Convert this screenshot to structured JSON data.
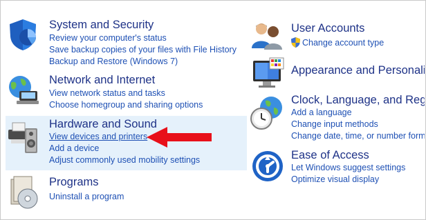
{
  "left_column": [
    {
      "id": "system-security",
      "title": "System and Security",
      "icon": "shield-icon",
      "links": [
        "Review your computer's status",
        "Save backup copies of your files with File History",
        "Backup and Restore (Windows 7)"
      ]
    },
    {
      "id": "network-internet",
      "title": "Network and Internet",
      "icon": "globe-network-icon",
      "links": [
        "View network status and tasks",
        "Choose homegroup and sharing options"
      ]
    },
    {
      "id": "hardware-sound",
      "title": "Hardware and Sound",
      "icon": "printer-speaker-icon",
      "links": [
        "View devices and printers",
        "Add a device",
        "Adjust commonly used mobility settings"
      ],
      "highlighted": true
    },
    {
      "id": "programs",
      "title": "Programs",
      "icon": "programs-disc-icon",
      "links": [
        "Uninstall a program"
      ]
    }
  ],
  "right_column": [
    {
      "id": "user-accounts",
      "title": "User Accounts",
      "icon": "users-icon",
      "links": [
        "Change account type"
      ],
      "link_icon": "uac-shield-icon"
    },
    {
      "id": "appearance",
      "title": "Appearance and Personalization",
      "icon": "monitor-palette-icon",
      "links": []
    },
    {
      "id": "clock-language",
      "title": "Clock, Language, and Region",
      "icon": "clock-globe-icon",
      "links": [
        "Add a language",
        "Change input methods",
        "Change date, time, or number formats"
      ]
    },
    {
      "id": "ease-of-access",
      "title": "Ease of Access",
      "icon": "ease-of-access-icon",
      "links": [
        "Let Windows suggest settings",
        "Optimize visual display"
      ]
    }
  ],
  "annotation": {
    "icon": "red-arrow-icon",
    "color": "#e8101a"
  },
  "colors": {
    "title": "#1e3287",
    "link": "#1e50b4",
    "highlight": "#e5f1fb"
  }
}
